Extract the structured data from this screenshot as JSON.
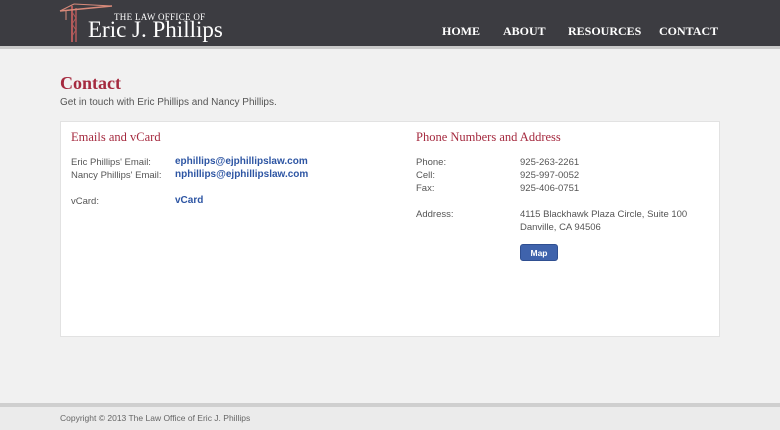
{
  "brand": {
    "line1": "THE LAW OFFICE OF",
    "line2": "Eric J. Phillips"
  },
  "nav": [
    {
      "label": "HOME"
    },
    {
      "label": "ABOUT"
    },
    {
      "label": "RESOURCES"
    },
    {
      "label": "CONTACT"
    }
  ],
  "page": {
    "title": "Contact",
    "subtitle": "Get in touch with Eric Phillips and Nancy Phillips."
  },
  "emails": {
    "title": "Emails and vCard",
    "rows": [
      {
        "label": "Eric Phillips' Email:",
        "value": "ephillips@ejphillipslaw.com"
      },
      {
        "label": "Nancy Phillips' Email:",
        "value": "nphillips@ejphillipslaw.com"
      },
      {
        "label": "vCard:",
        "value": "vCard"
      }
    ]
  },
  "phones": {
    "title": "Phone Numbers and Address",
    "rows": [
      {
        "label": "Phone:",
        "value": "925-263-2261"
      },
      {
        "label": "Cell:",
        "value": "925-997-0052"
      },
      {
        "label": "Fax:",
        "value": "925-406-0751"
      }
    ],
    "address_label": "Address:",
    "address_line1": "4115 Blackhawk Plaza Circle, Suite 100",
    "address_line2": "Danville, CA 94506",
    "map_label": "Map"
  },
  "footer": {
    "text": "Copyright © 2013 The Law Office of Eric J. Phillips"
  },
  "colors": {
    "header_bg": "#3c3c41",
    "accent": "#a52a3f",
    "link": "#2d55a3",
    "button": "#3f63ac"
  },
  "icons": {
    "logo_mark": "crane-logo-icon"
  }
}
